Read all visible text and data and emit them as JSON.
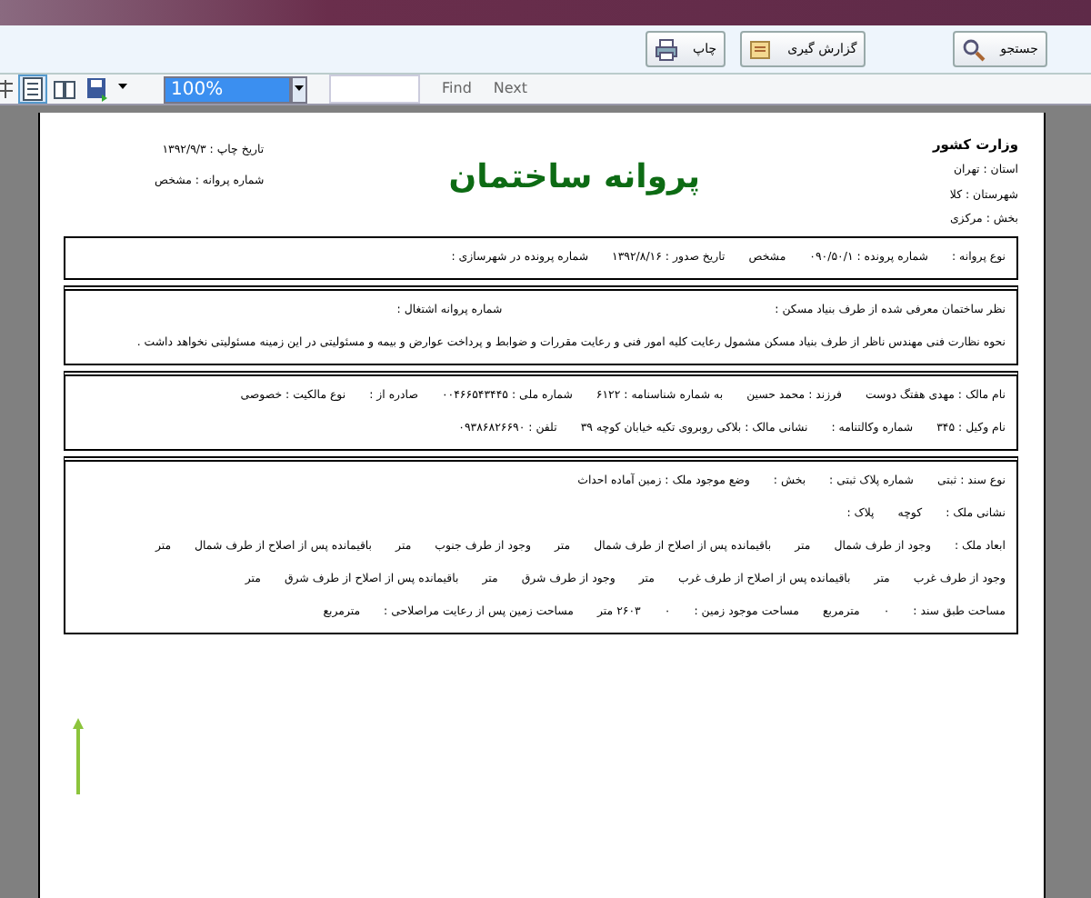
{
  "toolbar": {
    "buttons": [
      {
        "kind": "search",
        "label": "جستجو"
      },
      {
        "kind": "report",
        "label": "گزارش گیری"
      },
      {
        "kind": "print",
        "label": "چاپ"
      }
    ]
  },
  "viewer_bar": {
    "tools": [
      {
        "kind": "layout",
        "selected": true
      },
      {
        "kind": "book",
        "selected": false
      },
      {
        "kind": "save",
        "selected": false
      }
    ],
    "zoom": "100%",
    "find_label": "Find",
    "next_label": "Next"
  },
  "document": {
    "ministry": "وزارت کشور",
    "region_lines": [
      "استان : تهران",
      "شهرستان : کلا",
      "بخش : مرکزی"
    ],
    "title": "پروانه ساختمان",
    "print_info": [
      "تاریخ چاپ : ۱۳۹۲/۹/۳",
      "شماره پروانه : مشخص"
    ],
    "sections": [
      {
        "double_top": false,
        "lines": [
          {
            "fields": [
              "نوع پروانه :",
              "شماره پرونده : ۰۹۰/۵۰/۱",
              "مشخص",
              "تاریخ صدور : ۱۳۹۲/۸/۱۶",
              "شماره پرونده در شهرسازی :"
            ]
          }
        ]
      },
      {
        "double_top": true,
        "lines": [
          {
            "fields": [
              "نظر ساختمان معرفی شده از طرف بنیاد مسکن :",
              "شماره پروانه اشتغال :"
            ]
          },
          {
            "fields": [
              "نحوه نظارت فنی مهندس ناظر از طرف بنیاد مسکن مشمول رعایت کلیه امور فنی و رعایت مقررات و ضوابط و پرداخت عوارض و بیمه و مسئولیتی در این زمینه مسئولیتی نخواهد داشت ."
            ]
          }
        ]
      },
      {
        "double_top": true,
        "lines": [
          {
            "fields": [
              "نام مالک : مهدی هفتگ دوست",
              "فرزند : محمد حسین",
              "به شماره شناسنامه : ۶۱۲۲",
              "شماره ملی : ۰۰۴۶۶۵۴۳۴۴۵",
              "صادره از :",
              "نوع مالکیت : خصوصی"
            ]
          },
          {
            "fields": [
              "نام وکیل : ۳۴۵",
              "شماره وکالتنامه :",
              "نشانی مالک : بلاکی روبروی تکیه خیابان کوچه ۳۹",
              "تلفن : ۰۹۳۸۶۸۲۶۶۹۰"
            ]
          }
        ]
      },
      {
        "double_top": true,
        "lines": [
          {
            "fields": [
              "نوع سند : ثبتی",
              "شماره پلاک ثبتی :",
              "بخش :",
              "وضع موجود ملک : زمین آماده احداث"
            ]
          },
          {
            "fields": [
              "نشانی ملک :",
              "کوچه",
              "پلاک :"
            ]
          },
          {
            "fields": [
              "ابعاد ملک :",
              "وجود از طرف شمال",
              "متر",
              "باقیمانده پس از اصلاح از طرف شمال",
              "متر",
              "وجود از طرف جنوب",
              "متر",
              "باقیمانده پس از اصلاح از طرف شمال",
              "متر"
            ]
          },
          {
            "fields": [
              "وجود از طرف غرب",
              "متر",
              "باقیمانده پس از اصلاح از طرف غرب",
              "متر",
              "وجود از طرف شرق",
              "متر",
              "باقیمانده پس از اصلاح از طرف شرق",
              "متر"
            ]
          },
          {
            "fields": [
              "مساحت طبق سند :",
              "۰",
              "مترمربع",
              "مساحت موجود زمین :",
              "۰",
              "۲۶۰۳ متر",
              "مساحت زمین پس از رعایت مراصلاحی :",
              "مترمربع"
            ]
          }
        ]
      }
    ]
  }
}
